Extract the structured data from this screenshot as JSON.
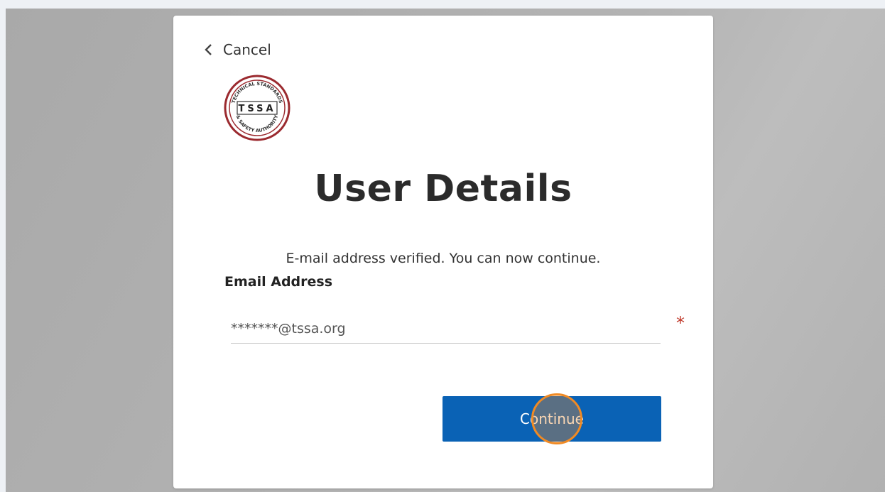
{
  "card": {
    "cancel_label": "Cancel",
    "title": "User Details",
    "verified_message": "E-mail address verified. You can now continue.",
    "email_label": "Email Address",
    "email_value": "*******@tssa.org",
    "required_mark": "*",
    "continue_label": "Continue"
  },
  "logo": {
    "top_text": "TECHNICAL STANDARDS",
    "center_text": "TSSA",
    "bottom_text": "& SAFETY AUTHORITY",
    "color": "#9b2a2f"
  },
  "colors": {
    "button_blue": "#0a62b5",
    "required_red": "#c0392b",
    "click_marker": "#f08a24"
  }
}
